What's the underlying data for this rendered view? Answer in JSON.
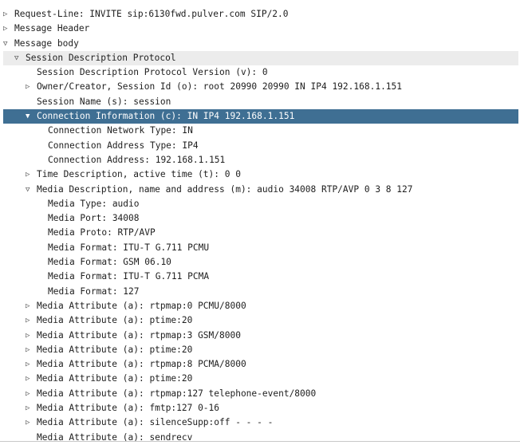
{
  "rows": [
    {
      "depth": 0,
      "toggle": "collapsed",
      "text": "Request-Line: INVITE sip:6130fwd.pulver.com SIP/2.0"
    },
    {
      "depth": 0,
      "toggle": "collapsed",
      "text": "Message Header"
    },
    {
      "depth": 0,
      "toggle": "expanded",
      "text": "Message body"
    },
    {
      "depth": 1,
      "toggle": "expanded",
      "text": "Session Description Protocol"
    },
    {
      "depth": 2,
      "toggle": "none",
      "text": "Session Description Protocol Version (v): 0"
    },
    {
      "depth": 2,
      "toggle": "collapsed",
      "text": "Owner/Creator, Session Id (o): root 20990 20990 IN IP4 192.168.1.151"
    },
    {
      "depth": 2,
      "toggle": "none",
      "text": "Session Name (s): session"
    },
    {
      "depth": 2,
      "toggle": "expanded",
      "text": "Connection Information (c): IN IP4 192.168.1.151",
      "selected": true
    },
    {
      "depth": 3,
      "toggle": "none",
      "text": "Connection Network Type: IN"
    },
    {
      "depth": 3,
      "toggle": "none",
      "text": "Connection Address Type: IP4"
    },
    {
      "depth": 3,
      "toggle": "none",
      "text": "Connection Address: 192.168.1.151"
    },
    {
      "depth": 2,
      "toggle": "collapsed",
      "text": "Time Description, active time (t): 0 0"
    },
    {
      "depth": 2,
      "toggle": "expanded",
      "text": "Media Description, name and address (m): audio 34008 RTP/AVP 0 3 8 127"
    },
    {
      "depth": 3,
      "toggle": "none",
      "text": "Media Type: audio"
    },
    {
      "depth": 3,
      "toggle": "none",
      "text": "Media Port: 34008"
    },
    {
      "depth": 3,
      "toggle": "none",
      "text": "Media Proto: RTP/AVP"
    },
    {
      "depth": 3,
      "toggle": "none",
      "text": "Media Format: ITU-T G.711 PCMU"
    },
    {
      "depth": 3,
      "toggle": "none",
      "text": "Media Format: GSM 06.10"
    },
    {
      "depth": 3,
      "toggle": "none",
      "text": "Media Format: ITU-T G.711 PCMA"
    },
    {
      "depth": 3,
      "toggle": "none",
      "text": "Media Format: 127"
    },
    {
      "depth": 2,
      "toggle": "collapsed",
      "text": "Media Attribute (a): rtpmap:0 PCMU/8000"
    },
    {
      "depth": 2,
      "toggle": "collapsed",
      "text": "Media Attribute (a): ptime:20"
    },
    {
      "depth": 2,
      "toggle": "collapsed",
      "text": "Media Attribute (a): rtpmap:3 GSM/8000"
    },
    {
      "depth": 2,
      "toggle": "collapsed",
      "text": "Media Attribute (a): ptime:20"
    },
    {
      "depth": 2,
      "toggle": "collapsed",
      "text": "Media Attribute (a): rtpmap:8 PCMA/8000"
    },
    {
      "depth": 2,
      "toggle": "collapsed",
      "text": "Media Attribute (a): ptime:20"
    },
    {
      "depth": 2,
      "toggle": "collapsed",
      "text": "Media Attribute (a): rtpmap:127 telephone-event/8000"
    },
    {
      "depth": 2,
      "toggle": "collapsed",
      "text": "Media Attribute (a): fmtp:127 0-16"
    },
    {
      "depth": 2,
      "toggle": "collapsed",
      "text": "Media Attribute (a): silenceSupp:off - - - -"
    },
    {
      "depth": 2,
      "toggle": "none",
      "text": "Media Attribute (a): sendrecv"
    }
  ],
  "icons": {
    "collapsed": "▷",
    "expanded": "▽",
    "expanded_selected": "▼"
  },
  "colors": {
    "selection": "#3f6f93",
    "text": "#1e1e1e",
    "hover_row": "#ececec"
  }
}
